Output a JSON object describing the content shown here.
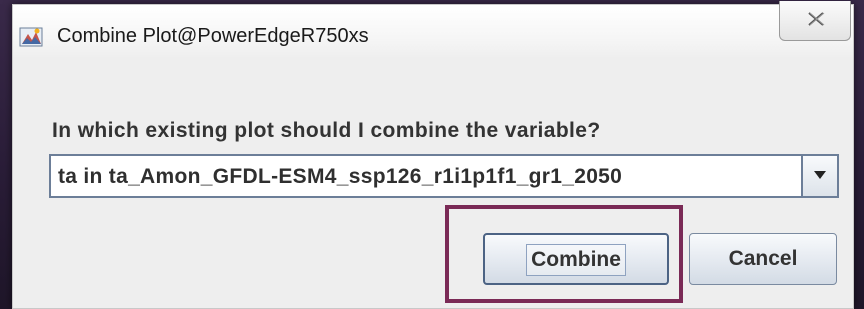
{
  "window": {
    "title": "Combine Plot@PowerEdgeR750xs",
    "app_icon": "java-dialog-icon",
    "close_icon": "close-icon",
    "background_hint_1": "",
    "background_hint_2": ""
  },
  "dialog": {
    "prompt": "In which existing plot should I combine the variable?",
    "plot_select": {
      "selected": "ta in ta_Amon_GFDL-ESM4_ssp126_r1i1p1f1_gr1_2050",
      "arrow_icon": "chevron-down-icon"
    },
    "combine_label": "Combine",
    "cancel_label": "Cancel"
  },
  "annotation": {
    "highlight_color": "#7a2a56",
    "highlight_target": "combine-button"
  }
}
